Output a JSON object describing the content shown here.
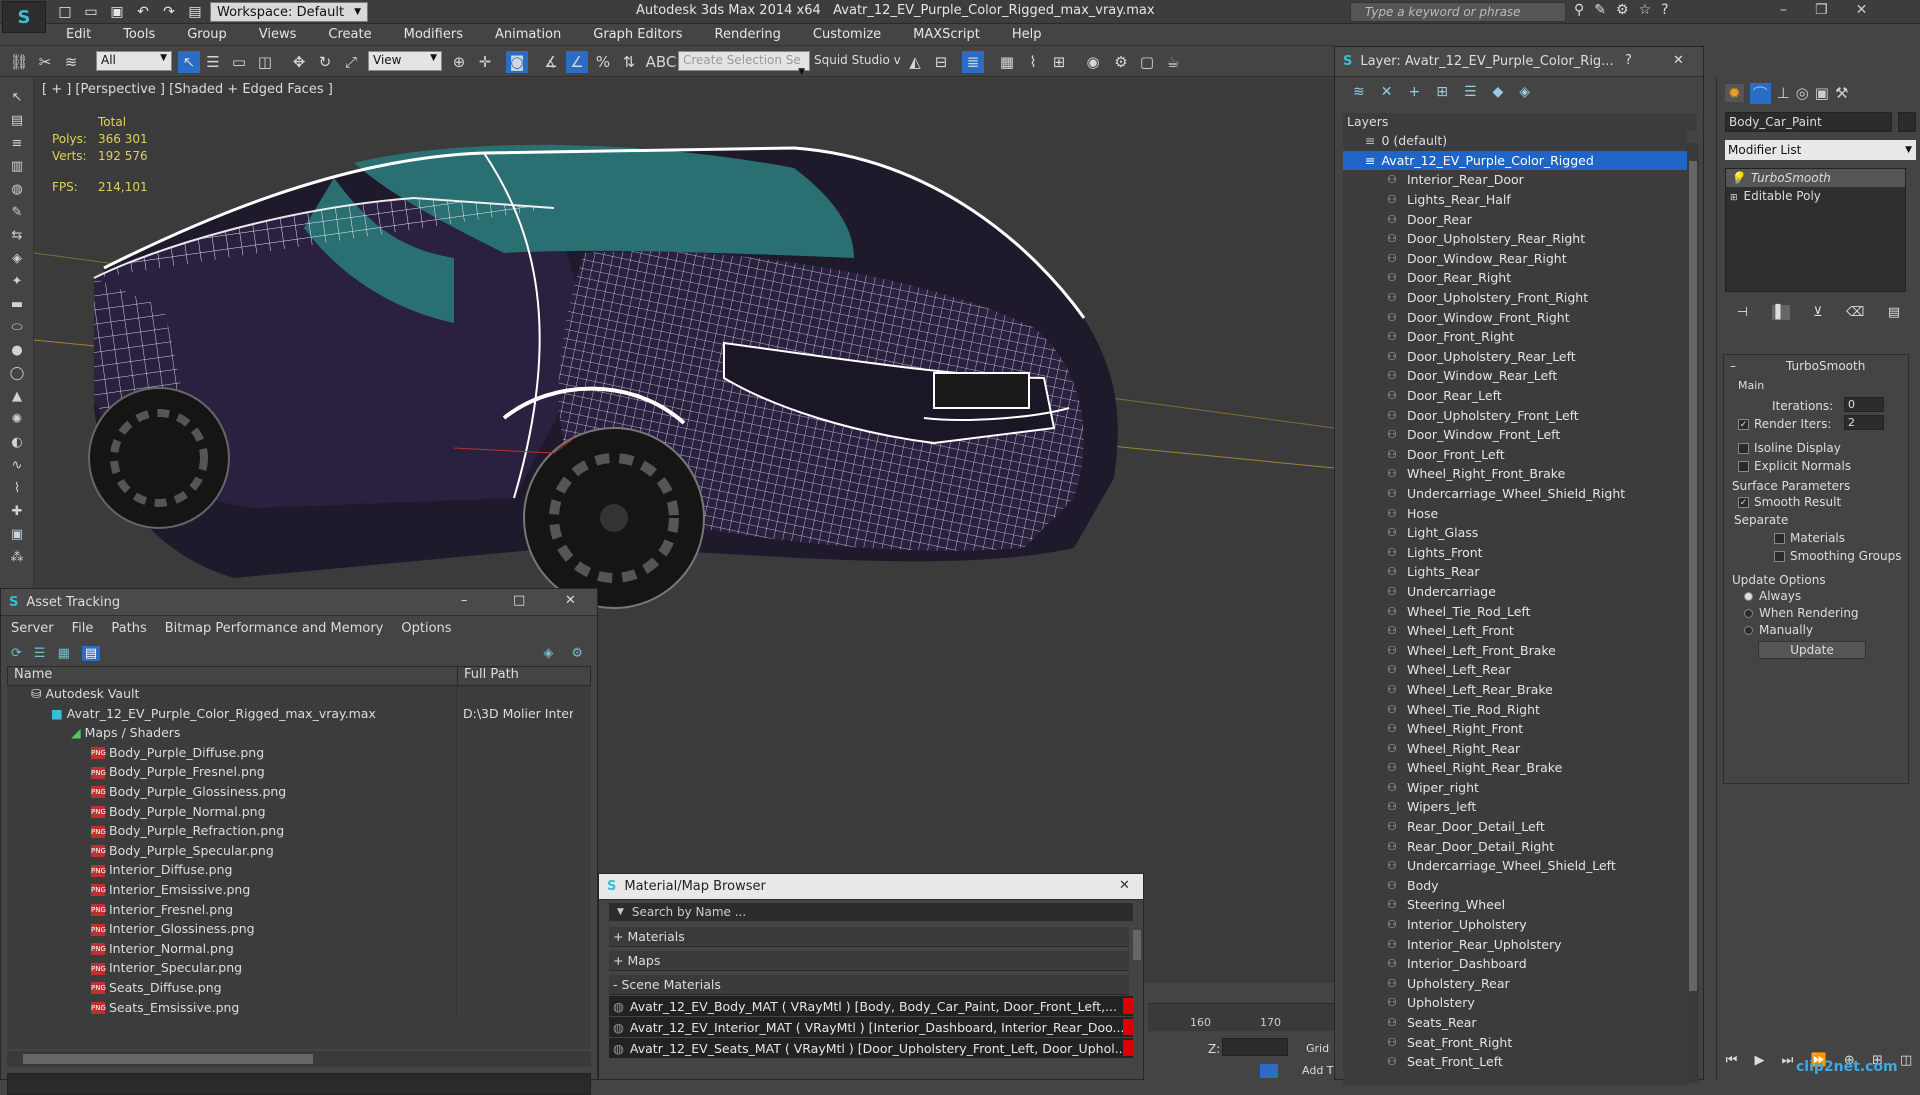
{
  "app": {
    "title": "Autodesk 3ds Max  2014 x64",
    "file": "Avatr_12_EV_Purple_Color_Rigged_max_vray.max",
    "workspace": "Workspace: Default",
    "search_placeholder": "Type a keyword or phrase"
  },
  "menu": [
    "Edit",
    "Tools",
    "Group",
    "Views",
    "Create",
    "Modifiers",
    "Animation",
    "Graph Editors",
    "Rendering",
    "Customize",
    "MAXScript",
    "Help"
  ],
  "toolbar": {
    "filter": "All",
    "ref_coord": "View",
    "selection_set": "Create Selection Se",
    "squid": "Squid Studio v"
  },
  "viewport": {
    "label": "[ + ] [Perspective ] [Shaded + Edged Faces ]",
    "stats_header": "Total",
    "polys_label": "Polys:",
    "polys": "366 301",
    "verts_label": "Verts:",
    "verts": "192 576",
    "fps_label": "FPS:",
    "fps": "214,101"
  },
  "asset_tracking": {
    "title": "Asset Tracking",
    "menu": [
      "Server",
      "File",
      "Paths",
      "Bitmap Performance and Memory",
      "Options"
    ],
    "columns": [
      "Name",
      "Full Path"
    ],
    "vault": "Autodesk Vault",
    "file": "Avatr_12_EV_Purple_Color_Rigged_max_vray.max",
    "file_path": "D:\\3D Molier Inter",
    "group": "Maps / Shaders",
    "maps": [
      "Body_Purple_Diffuse.png",
      "Body_Purple_Fresnel.png",
      "Body_Purple_Glossiness.png",
      "Body_Purple_Normal.png",
      "Body_Purple_Refraction.png",
      "Body_Purple_Specular.png",
      "Interior_Diffuse.png",
      "Interior_Emsissive.png",
      "Interior_Fresnel.png",
      "Interior_Glossiness.png",
      "Interior_Normal.png",
      "Interior_Specular.png",
      "Seats_Diffuse.png",
      "Seats_Emsissive.png"
    ]
  },
  "material_browser": {
    "title": "Material/Map Browser",
    "search_placeholder": "Search by Name ...",
    "sections": [
      "+ Materials",
      "+ Maps",
      "- Scene Materials"
    ],
    "materials": [
      "Avatr_12_EV_Body_MAT ( VRayMtl ) [Body, Body_Car_Paint, Door_Front_Left,...",
      "Avatr_12_EV_Interior_MAT ( VRayMtl ) [Interior_Dashboard, Interior_Rear_Doo...",
      "Avatr_12_EV_Seats_MAT ( VRayMtl ) [Door_Upholstery_Front_Left, Door_Uphol..."
    ]
  },
  "layers": {
    "title": "Layer: Avatr_12_EV_Purple_Color_Rig...",
    "header": "Layers",
    "default_layer": "0 (default)",
    "selected_layer": "Avatr_12_EV_Purple_Color_Rigged",
    "items": [
      "Interior_Rear_Door",
      "Lights_Rear_Half",
      "Door_Rear",
      "Door_Upholstery_Rear_Right",
      "Door_Window_Rear_Right",
      "Door_Rear_Right",
      "Door_Upholstery_Front_Right",
      "Door_Window_Front_Right",
      "Door_Front_Right",
      "Door_Upholstery_Rear_Left",
      "Door_Window_Rear_Left",
      "Door_Rear_Left",
      "Door_Upholstery_Front_Left",
      "Door_Window_Front_Left",
      "Door_Front_Left",
      "Wheel_Right_Front_Brake",
      "Undercarriage_Wheel_Shield_Right",
      "Hose",
      "Light_Glass",
      "Lights_Front",
      "Lights_Rear",
      "Undercarriage",
      "Wheel_Tie_Rod_Left",
      "Wheel_Left_Front",
      "Wheel_Left_Front_Brake",
      "Wheel_Left_Rear",
      "Wheel_Left_Rear_Brake",
      "Wheel_Tie_Rod_Right",
      "Wheel_Right_Front",
      "Wheel_Right_Rear",
      "Wheel_Right_Rear_Brake",
      "Wiper_right",
      "Wipers_left",
      "Rear_Door_Detail_Left",
      "Rear_Door_Detail_Right",
      "Undercarriage_Wheel_Shield_Left",
      "Body",
      "Steering_Wheel",
      "Interior_Upholstery",
      "Interior_Rear_Upholstery",
      "Interior_Dashboard",
      "Upholstery_Rear",
      "Upholstery",
      "Seats_Rear",
      "Seat_Front_Right",
      "Seat_Front_Left"
    ]
  },
  "command_panel": {
    "object_name": "Body_Car_Paint",
    "modifier_list": "Modifier List",
    "stack": [
      "TurboSmooth",
      "Editable Poly"
    ],
    "rollout_title": "TurboSmooth",
    "main": "Main",
    "iterations_label": "Iterations:",
    "iterations": "0",
    "render_iters_label": "Render Iters:",
    "render_iters": "2",
    "isoline": "Isoline Display",
    "explicit_normals": "Explicit Normals",
    "surface_params": "Surface Parameters",
    "smooth_result": "Smooth Result",
    "separate": "Separate",
    "materials": "Materials",
    "smoothing_groups": "Smoothing Groups",
    "update_options": "Update Options",
    "always": "Always",
    "when_rendering": "When Rendering",
    "manually": "Manually",
    "update_button": "Update"
  },
  "timeline": {
    "ticks": [
      "160",
      "170"
    ],
    "z_label": "Z:",
    "grid_label": "Grid",
    "add_label": "Add T"
  },
  "watermark": "clip2net.com"
}
